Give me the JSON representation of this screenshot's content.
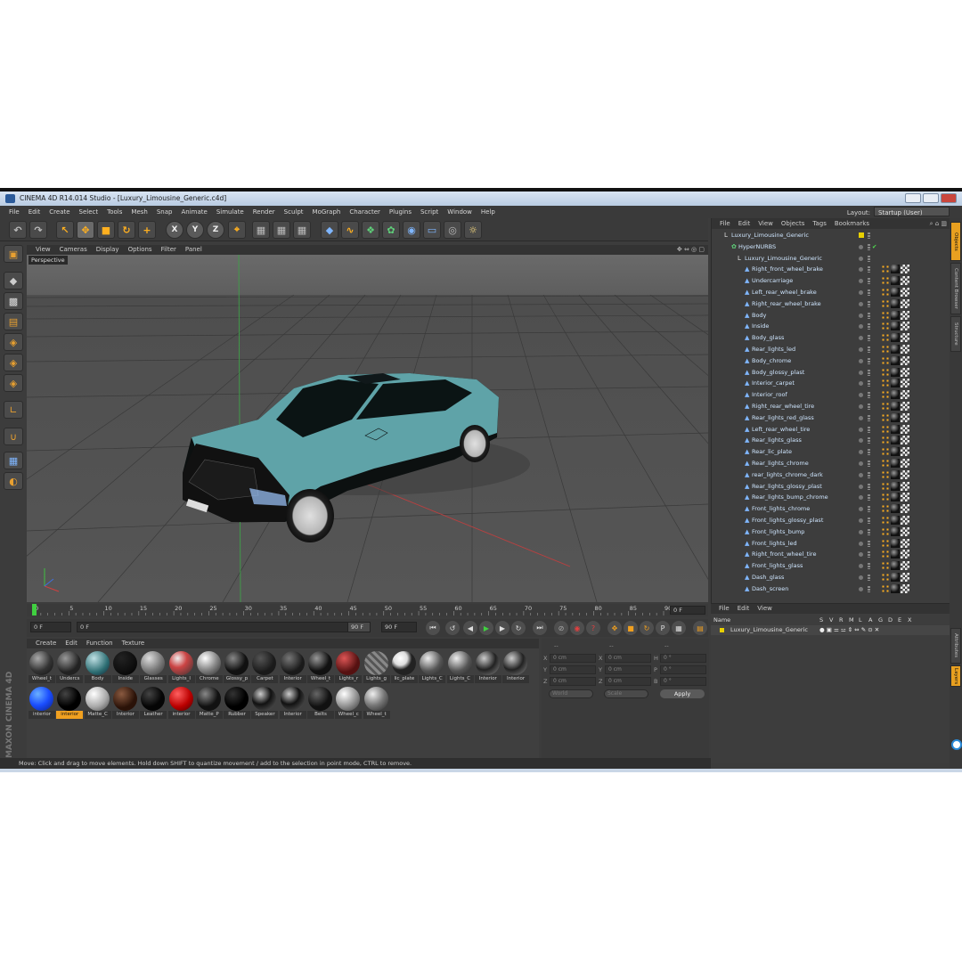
{
  "window": {
    "title": "CINEMA 4D R14.014 Studio - [Luxury_Limousine_Generic.c4d]"
  },
  "menubar": {
    "items": [
      "File",
      "Edit",
      "Create",
      "Select",
      "Tools",
      "Mesh",
      "Snap",
      "Animate",
      "Simulate",
      "Render",
      "Sculpt",
      "MoGraph",
      "Character",
      "Plugins",
      "Script",
      "Window",
      "Help"
    ],
    "layout_label": "Layout:",
    "layout_value": "Startup (User)"
  },
  "toolbar": {
    "axis_x": "X",
    "axis_y": "Y",
    "axis_z": "Z"
  },
  "viewport": {
    "menu": [
      "View",
      "Cameras",
      "Display",
      "Options",
      "Filter",
      "Panel"
    ],
    "label": "Perspective"
  },
  "timeline": {
    "ticks": [
      "0",
      "5",
      "10",
      "15",
      "20",
      "25",
      "30",
      "35",
      "40",
      "45",
      "50",
      "55",
      "60",
      "65",
      "70",
      "75",
      "80",
      "85",
      "90"
    ],
    "current_frame": "0 F"
  },
  "timecontrols": {
    "start": "0 F",
    "range_start": "0 F",
    "range_end": "90 F",
    "end": "90 F"
  },
  "materials": {
    "menu": [
      "Create",
      "Edit",
      "Function",
      "Texture"
    ],
    "row1": [
      "Wheel_t",
      "Undercs",
      "Body",
      "Inside",
      "Glasses",
      "Lights_l",
      "Chrome",
      "Glossy_p",
      "Carpet",
      "Interior",
      "Wheel_t",
      "Lights_r",
      "Lights_g",
      "lic_plate",
      "Lights_C",
      "Lights_C",
      "Interior",
      "Interior"
    ],
    "row2": [
      "interior",
      "interior",
      "Matte_C",
      "Interior",
      "Leather",
      "interior",
      "Matte_P",
      "Rubber",
      "Speaker",
      "Interior",
      "Belts",
      "Wheel_c",
      "Wheel_t"
    ],
    "highlighted": "interior"
  },
  "coords": {
    "header": [
      "--",
      "--",
      "--"
    ],
    "rows": [
      {
        "a": "X",
        "av": "0 cm",
        "b": "X",
        "bv": "0 cm",
        "c": "H",
        "cv": "0 °"
      },
      {
        "a": "Y",
        "av": "0 cm",
        "b": "Y",
        "bv": "0 cm",
        "c": "P",
        "cv": "0 °"
      },
      {
        "a": "Z",
        "av": "0 cm",
        "b": "Z",
        "bv": "0 cm",
        "c": "B",
        "cv": "0 °"
      }
    ],
    "world": "World",
    "scale": "Scale",
    "apply": "Apply"
  },
  "objects": {
    "menu": [
      "File",
      "Edit",
      "View",
      "Objects",
      "Tags",
      "Bookmarks"
    ],
    "root": "Luxury_Limousine_Generic",
    "hypernurbs": "HyperNURBS",
    "group": "Luxury_Limousine_Generic",
    "items": [
      "Right_front_wheel_brake",
      "Undercarriage",
      "Left_rear_wheel_brake",
      "Right_rear_wheel_brake",
      "Body",
      "Inside",
      "Body_glass",
      "Rear_lights_led",
      "Body_chrome",
      "Body_glossy_plast",
      "Interior_carpet",
      "Interior_roof",
      "Right_rear_wheel_tire",
      "Rear_lights_red_glass",
      "Left_rear_wheel_tire",
      "Rear_lights_glass",
      "Rear_lic_plate",
      "Rear_lights_chrome",
      "rear_lights_chrome_dark",
      "Rear_lights_glossy_plast",
      "Rear_lights_bump_chrome",
      "Front_lights_chrome",
      "Front_lights_glossy_plast",
      "Front_lights_bump",
      "Front_lights_led",
      "Right_front_wheel_tire",
      "Front_lights_glass",
      "Dash_glass",
      "Dash_screen"
    ]
  },
  "attributes": {
    "menu": [
      "File",
      "Edit",
      "View"
    ],
    "name_col": "Name",
    "cols": [
      "S",
      "V",
      "R",
      "M",
      "L",
      "A",
      "G",
      "D",
      "E",
      "X"
    ],
    "row": "Luxury_Limousine_Generic"
  },
  "sidetabs": [
    "Objects",
    "Content Browser",
    "Structure",
    "Attributes",
    "Layers"
  ],
  "status": "Move: Click and drag to move elements. Hold down SHIFT to quantize movement / add to the selection in point mode, CTRL to remove.",
  "branding": "MAXON CINEMA 4D"
}
